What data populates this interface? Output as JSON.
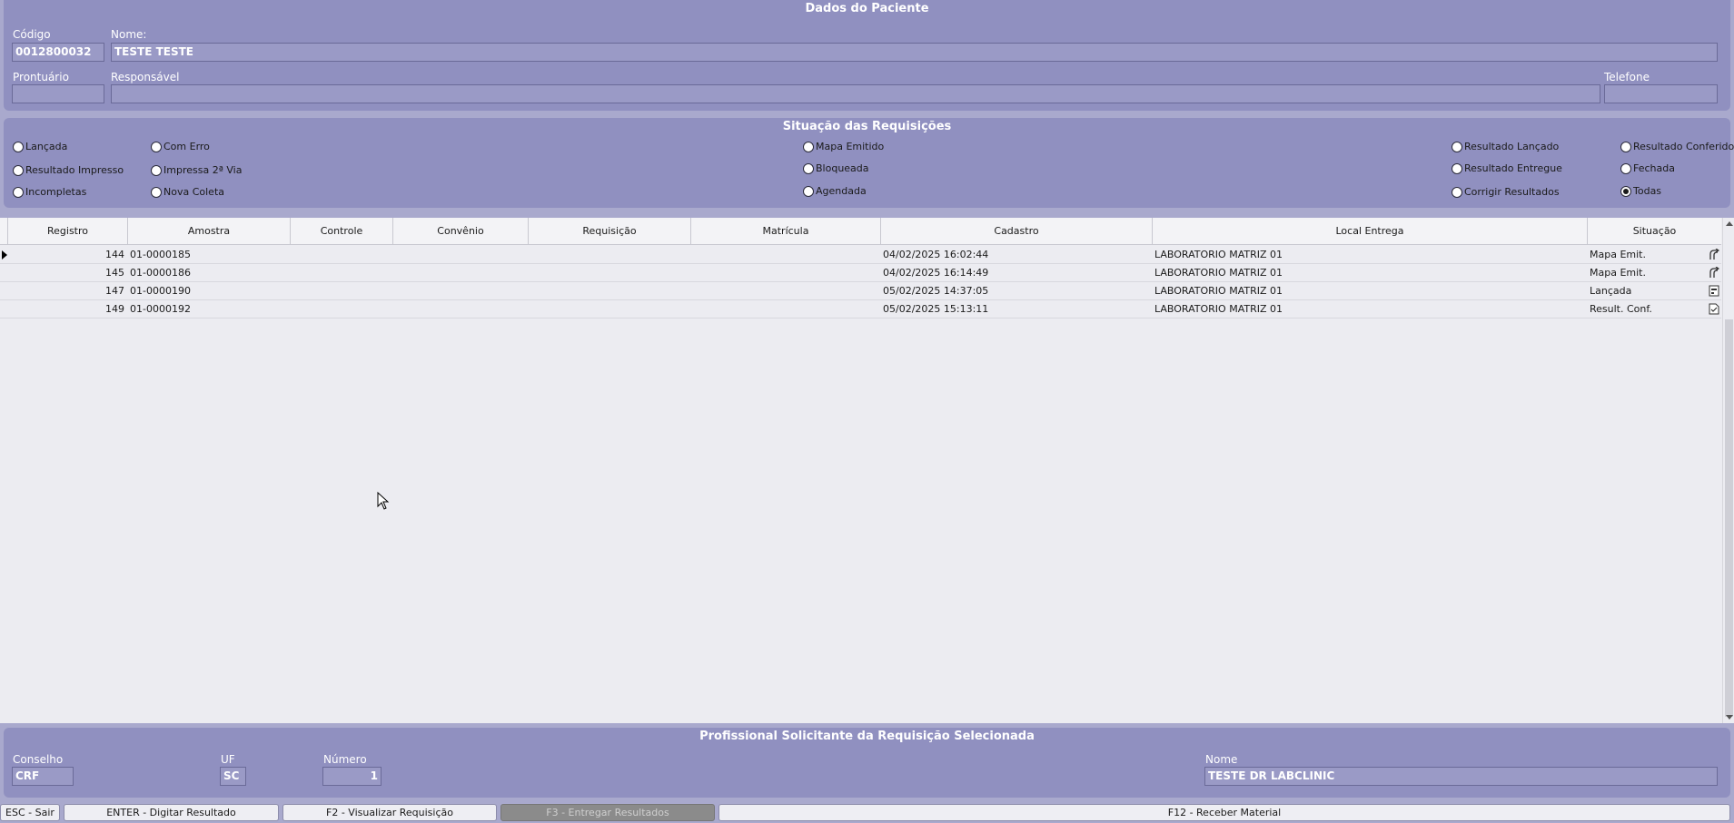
{
  "paciente": {
    "title": "Dados do Paciente",
    "codigo_label": "Código",
    "codigo_value": "0012800032",
    "nome_label": "Nome:",
    "nome_value": "TESTE TESTE",
    "prontuario_label": "Prontuário",
    "prontuario_value": "",
    "responsavel_label": "Responsável",
    "responsavel_value": "",
    "telefone_label": "Telefone",
    "telefone_value": ""
  },
  "situacao": {
    "title": "Situação das Requisições",
    "options": [
      {
        "label": "Lançada",
        "checked": false
      },
      {
        "label": "Resultado Impresso",
        "checked": false
      },
      {
        "label": "Incompletas",
        "checked": false
      },
      {
        "label": "Com Erro",
        "checked": false
      },
      {
        "label": "Impressa 2ª Via",
        "checked": false
      },
      {
        "label": "Nova Coleta",
        "checked": false
      },
      {
        "label": "Mapa Emitido",
        "checked": false
      },
      {
        "label": "Bloqueada",
        "checked": false
      },
      {
        "label": "Agendada",
        "checked": false
      },
      {
        "label": "Resultado Lançado",
        "checked": false
      },
      {
        "label": "Resultado Entregue",
        "checked": false
      },
      {
        "label": "Corrigir Resultados",
        "checked": false
      },
      {
        "label": "Resultado Conferido",
        "checked": false
      },
      {
        "label": "Fechada",
        "checked": false
      },
      {
        "label": "Todas",
        "checked": true
      }
    ]
  },
  "grid": {
    "columns": [
      "Registro",
      "Amostra",
      "Controle",
      "Convênio",
      "Requisição",
      "Matrícula",
      "Cadastro",
      "Local Entrega",
      "Situação"
    ],
    "rows": [
      {
        "registro": "144",
        "amostra": "01-0000185",
        "controle": "",
        "convenio": "",
        "requisicao": "",
        "matricula": "",
        "cadastro": "04/02/2025 16:02:44",
        "local": "LABORATORIO MATRIZ 01",
        "situacao": "Mapa Emit.",
        "icon": "branch-icon"
      },
      {
        "registro": "145",
        "amostra": "01-0000186",
        "controle": "",
        "convenio": "",
        "requisicao": "",
        "matricula": "",
        "cadastro": "04/02/2025 16:14:49",
        "local": "LABORATORIO MATRIZ 01",
        "situacao": "Mapa Emit.",
        "icon": "branch-icon"
      },
      {
        "registro": "147",
        "amostra": "01-0000190",
        "controle": "",
        "convenio": "",
        "requisicao": "",
        "matricula": "",
        "cadastro": "05/02/2025 14:37:05",
        "local": "LABORATORIO MATRIZ 01",
        "situacao": "Lançada",
        "icon": "form-icon"
      },
      {
        "registro": "149",
        "amostra": "01-0000192",
        "controle": "",
        "convenio": "",
        "requisicao": "",
        "matricula": "",
        "cadastro": "05/02/2025 15:13:11",
        "local": "LABORATORIO MATRIZ 01",
        "situacao": "Result. Conf.",
        "icon": "doc-check-icon"
      }
    ]
  },
  "profissional": {
    "title": "Profissional Solicitante da Requisição Selecionada",
    "conselho_label": "Conselho",
    "conselho_value": "CRF",
    "uf_label": "UF",
    "uf_value": "SC",
    "numero_label": "Número",
    "numero_value": "1",
    "nome_label": "Nome",
    "nome_value": "TESTE DR LABCLINIC"
  },
  "fkeys": [
    {
      "label": "ESC - Sair",
      "disabled": false
    },
    {
      "label": "ENTER - Digitar Resultado",
      "disabled": false
    },
    {
      "label": "F2 - Visualizar Requisição",
      "disabled": false
    },
    {
      "label": "F3 - Entregar Resultados",
      "disabled": true
    },
    {
      "label": "F12 - Receber Material",
      "disabled": false
    }
  ]
}
